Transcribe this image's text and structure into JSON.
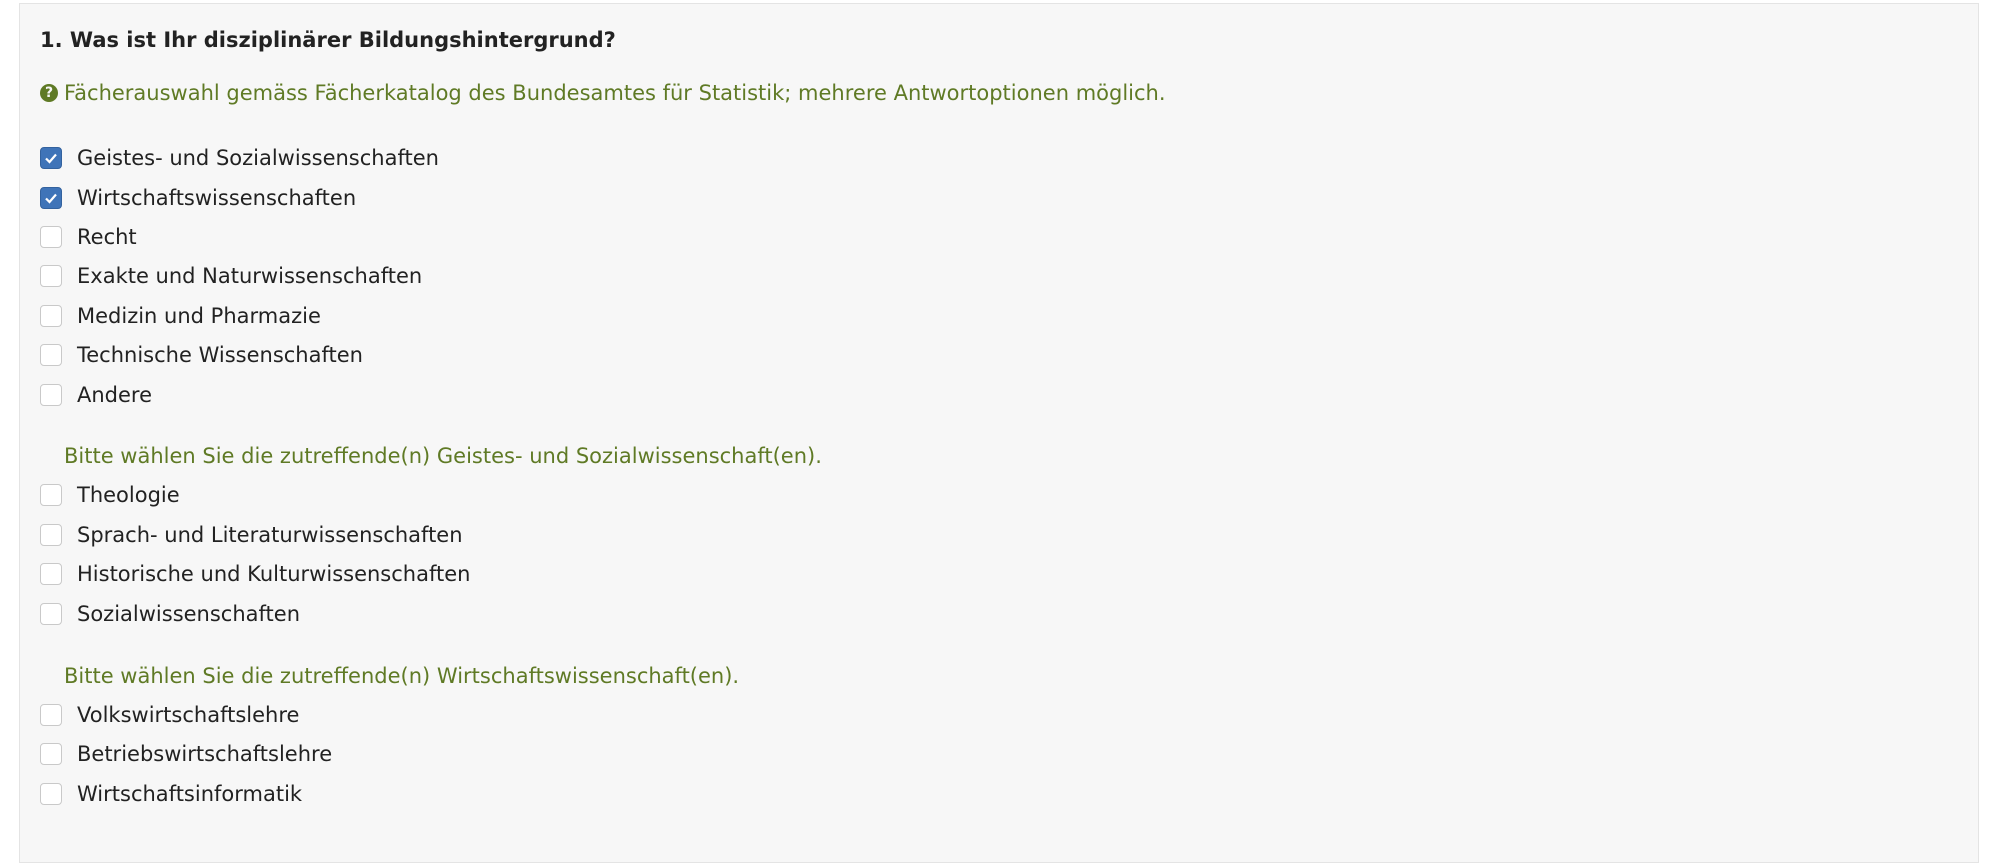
{
  "question": {
    "title": "1. Was ist Ihr disziplinärer Bildungshintergrund?",
    "help_icon": "question-circle-icon",
    "help_text": "Fächerauswahl gemäss Fächerkatalog des Bundesamtes für Statistik; mehrere Antwortoptionen möglich."
  },
  "main_options": [
    {
      "label": "Geistes- und Sozialwissenschaften",
      "checked": true
    },
    {
      "label": "Wirtschaftswissenschaften",
      "checked": true
    },
    {
      "label": "Recht",
      "checked": false
    },
    {
      "label": "Exakte und Naturwissenschaften",
      "checked": false
    },
    {
      "label": "Medizin und Pharmazie",
      "checked": false
    },
    {
      "label": "Technische Wissenschaften",
      "checked": false
    },
    {
      "label": "Andere",
      "checked": false
    }
  ],
  "sub_sections": [
    {
      "heading": "Bitte wählen Sie die zutreffende(n) Geistes- und Sozialwissenschaft(en).",
      "options": [
        {
          "label": "Theologie",
          "checked": false
        },
        {
          "label": "Sprach- und Literaturwissenschaften",
          "checked": false
        },
        {
          "label": "Historische und Kulturwissenschaften",
          "checked": false
        },
        {
          "label": "Sozialwissenschaften",
          "checked": false
        }
      ]
    },
    {
      "heading": "Bitte wählen Sie die zutreffende(n) Wirtschaftswissenschaft(en).",
      "options": [
        {
          "label": "Volkswirtschaftslehre",
          "checked": false
        },
        {
          "label": "Betriebswirtschaftslehre",
          "checked": false
        },
        {
          "label": "Wirtschaftsinformatik",
          "checked": false
        }
      ]
    }
  ],
  "colors": {
    "panel_bg": "#f7f7f7",
    "help_text": "#5f7a25",
    "checkbox_checked": "#3f74b8",
    "text": "#222222"
  }
}
